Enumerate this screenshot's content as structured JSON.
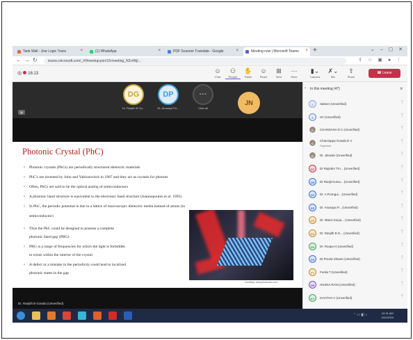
{
  "browser": {
    "tabs": [
      {
        "label": "Tank Wall - Jive Logic Trans",
        "icon_color": "#e06c3c"
      },
      {
        "label": "(1) WhatsApp",
        "icon_color": "#25d366"
      },
      {
        "label": "PDF Scanner Translate - Google",
        "icon_color": "#4a7fd4"
      },
      {
        "label": "Meeting now | Microsoft Teams",
        "icon_color": "#5b5fc7"
      }
    ],
    "url": "teams.microsoft.com/_#/l/meetup-join/19:meeting_N2c4NjI..."
  },
  "meeting": {
    "timer": "16:13",
    "toolbar": [
      "Chat",
      "People",
      "Raise",
      "React",
      "View",
      "More"
    ],
    "devices": [
      "Camera",
      "Mic",
      "Share"
    ],
    "leave_label": "Leave",
    "tiles": [
      {
        "initials": "DG",
        "name": "Dr. Ranjith B Go...",
        "color": "#c8a53a"
      },
      {
        "initials": "DP",
        "name": "Dr. Anusaya Pa...",
        "color": "#3d9fd9"
      }
    ],
    "view_all": "View all",
    "jn_initials": "JN"
  },
  "slide": {
    "title": "Photonic Crystal (PhC)",
    "bullets_top": [
      "Photonic crystals (PhCs) are periodically structured dielectric materials",
      "PhC's are invented by John and Yablonovitch in 1987 and they act as crystals for photons",
      "Often, PhCs are said to be the optical analog of semiconductors",
      "A photonic band structure is equivalent to the electronic band structure (Joannopoulos et al. 1995)",
      "In PhC, the periodic potential is due to a lattice of macroscopic dielectric media instead of atoms (in"
    ],
    "bullet_top_cont": "semiconductor)",
    "bullets_left": [
      {
        "l1": "Thus the PhC could be designed to possess a complete",
        "l2": "photonic band gap (PBG)"
      },
      {
        "l1": "PBG is a range of frequencies for which the light is forbidden",
        "l2": "to exists within the interior of the crystal"
      },
      {
        "l1": "A defect or a mistake in the periodicity could lead to localized",
        "l2": "photonic states in the gap"
      }
    ],
    "image_credit": "Courtesy: www.photonics.com",
    "presenter": "Dr. Ranjith B Gowda (Unverified)"
  },
  "participants": {
    "header": "In this meeting (47)",
    "items": [
      {
        "initials": "S",
        "name": "Sabeer (Unverified)",
        "color": "#8aa7d8",
        "bg": "#e3ebf8"
      },
      {
        "initials": "S",
        "name": "SV (Unverified)",
        "color": "#6a8fd0",
        "bg": "#e3ebf8"
      },
      {
        "initials": "C",
        "name": "CHANDANA D C (Unverified)",
        "color": "#ffffff",
        "bg": "#9a8c80"
      },
      {
        "initials": "C",
        "name": "Channappa Gowda D V",
        "sub": "Organizer",
        "color": "#ffffff",
        "bg": "#9a8c80"
      },
      {
        "initials": "D",
        "name": "Dr. Jitender (Unverified)",
        "color": "#ffffff",
        "bg": "#9a8c80"
      },
      {
        "initials": "DT",
        "name": "Dr Rajinder Tm... (Unverified)",
        "color": "#c4314b",
        "bg": "#f6dadd"
      },
      {
        "initials": "DB",
        "name": "Dr Ranjit Kuma... (Unverified)",
        "color": "#3d6fd9",
        "bg": "#dde7f8"
      },
      {
        "initials": "DP",
        "name": "Dr. A Poongui... (Unverified)",
        "color": "#3d6fd9",
        "bg": "#dde7f8"
      },
      {
        "initials": "DP",
        "name": "Dr. Anusaya P... (Unverified)",
        "color": "#3d6fd9",
        "bg": "#dde7f8"
      },
      {
        "initials": "DS",
        "name": "Dr. Mansi Surya... (Unverified)",
        "color": "#c08a2a",
        "bg": "#f6ead3"
      },
      {
        "initials": "DG",
        "name": "Dr. Ranjith B G... (Unverified)",
        "color": "#c08a2a",
        "bg": "#f6ead3"
      },
      {
        "initials": "DH",
        "name": "Dr. Roopa H (Unverified)",
        "color": "#4a9e5c",
        "bg": "#dcefdf"
      },
      {
        "initials": "DS",
        "name": "Dr.Preeta Sharan (Unverified)",
        "color": "#3d6fd9",
        "bg": "#dde7f8"
      },
      {
        "initials": "FT",
        "name": "Feelia T (Unverified)",
        "color": "#c08a2a",
        "bg": "#f6ead3"
      },
      {
        "initials": "HR",
        "name": "HUSNA RANI (Unverified)",
        "color": "#7a52b8",
        "bg": "#e7dff4"
      },
      {
        "initials": "KV",
        "name": "KAVITHA V (Unverified)",
        "color": "#4a9e5c",
        "bg": "#dcefdf"
      }
    ]
  },
  "taskbar": {
    "apps": [
      {
        "name": "start-orb",
        "color": "#3a8fd8"
      },
      {
        "name": "explorer",
        "color": "#e8c15a"
      },
      {
        "name": "media-player",
        "color": "#e07a2a"
      },
      {
        "name": "chrome",
        "color": "#db4437"
      },
      {
        "name": "app-5",
        "color": "#3bb3d8"
      },
      {
        "name": "firefox",
        "color": "#e0602a"
      },
      {
        "name": "acrobat",
        "color": "#d42a2a"
      },
      {
        "name": "word",
        "color": "#2b5fb5"
      }
    ],
    "time": "10:31 AM",
    "date": "4/11/2024"
  },
  "colors": {
    "accent": "#5b5fc7",
    "leave": "#c4314b",
    "slide_title": "#b41e1e"
  }
}
